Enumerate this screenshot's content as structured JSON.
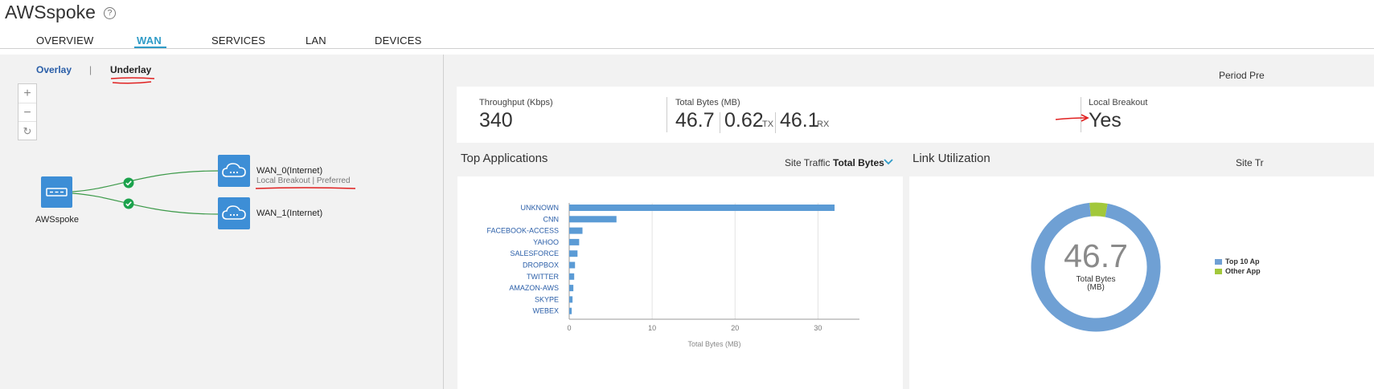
{
  "header": {
    "title": "AWSspoke",
    "help_icon": "question-circle-icon"
  },
  "tabs": [
    {
      "label": "OVERVIEW",
      "active": false
    },
    {
      "label": "WAN",
      "active": true
    },
    {
      "label": "SERVICES",
      "active": false
    },
    {
      "label": "LAN",
      "active": false
    },
    {
      "label": "DEVICES",
      "active": false
    }
  ],
  "topology": {
    "subtabs": {
      "overlay": "Overlay",
      "underlay": "Underlay",
      "separator": "|"
    },
    "zoom": {
      "in": "+",
      "out": "−",
      "reset": "↻"
    },
    "device": {
      "label": "AWSspoke",
      "icon": "router-icon"
    },
    "links": [
      {
        "name": "WAN_0(Internet)",
        "sub": "Local Breakout | Preferred",
        "status": "up"
      },
      {
        "name": "WAN_1(Internet)",
        "sub": "",
        "status": "up"
      }
    ]
  },
  "period": {
    "label": "Period Pre"
  },
  "metrics": {
    "throughput": {
      "label": "Throughput (Kbps)",
      "value": "340"
    },
    "total_bytes": {
      "label": "Total Bytes (MB)",
      "value": "46.7",
      "tx": "0.62",
      "tx_unit": "TX",
      "rx": "46.1",
      "rx_unit": "RX"
    },
    "local_breakout": {
      "label": "Local Breakout",
      "value": "Yes"
    }
  },
  "top_apps": {
    "title": "Top Applications",
    "site_traffic_label": "Site Traffic",
    "site_traffic_value": "Total Bytes"
  },
  "link_util": {
    "title": "Link Utilization",
    "site_traffic_label": "Site Tr",
    "center_value": "46.7",
    "center_label_1": "Total Bytes",
    "center_label_2": "(MB)"
  },
  "chart_data": [
    {
      "type": "bar",
      "orientation": "horizontal",
      "categories": [
        "UNKNOWN",
        "CNN",
        "FACEBOOK-ACCESS",
        "YAHOO",
        "SALESFORCE",
        "DROPBOX",
        "TWITTER",
        "AMAZON-AWS",
        "SKYPE",
        "WEBEX"
      ],
      "values": [
        32,
        5.7,
        1.6,
        1.2,
        1.0,
        0.7,
        0.6,
        0.5,
        0.4,
        0.3
      ],
      "xlabel": "Total Bytes (MB)",
      "xticks": [
        0,
        10,
        20,
        30
      ],
      "xlim": [
        0,
        35
      ],
      "color": "#5b9bd5",
      "grid": true
    },
    {
      "type": "pie",
      "style": "donut",
      "series": [
        {
          "name": "Top 10 Ap",
          "value": 44.6,
          "color": "#6fa0d4"
        },
        {
          "name": "Other App",
          "value": 2.1,
          "color": "#a2c83b"
        }
      ]
    }
  ]
}
